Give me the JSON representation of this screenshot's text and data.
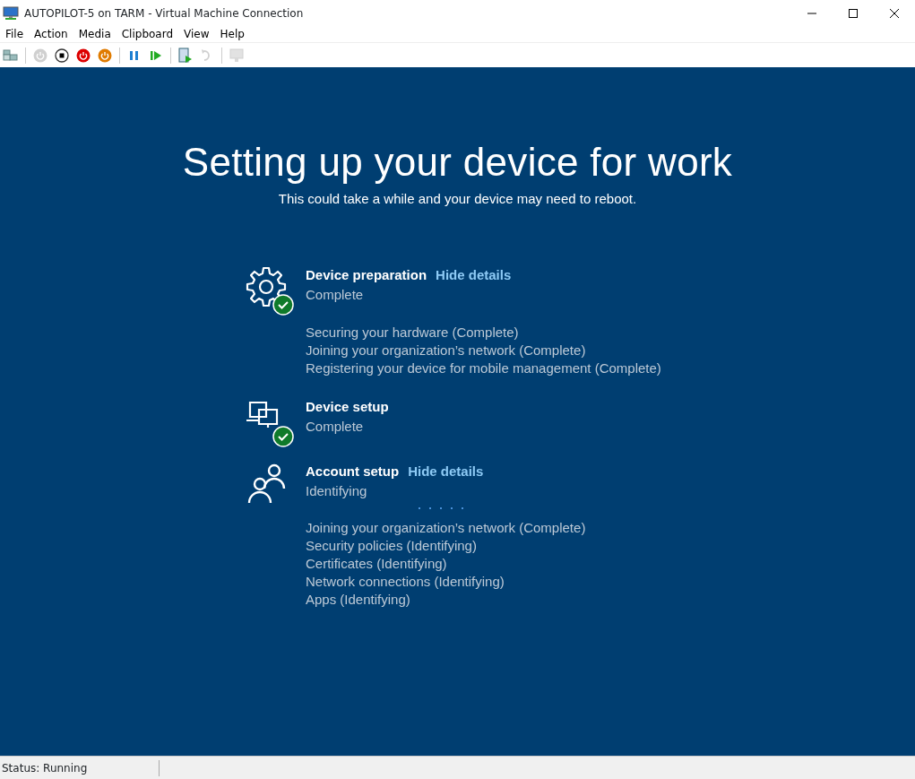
{
  "window": {
    "title": "AUTOPILOT-5 on TARM - Virtual Machine Connection"
  },
  "menu": [
    "File",
    "Action",
    "Media",
    "Clipboard",
    "View",
    "Help"
  ],
  "toolbar": [
    {
      "kind": "ctrlaltdel",
      "disabled": false
    },
    {
      "kind": "sep"
    },
    {
      "kind": "start",
      "disabled": true
    },
    {
      "kind": "turnoff",
      "disabled": false
    },
    {
      "kind": "shutdown",
      "disabled": false
    },
    {
      "kind": "save",
      "disabled": false
    },
    {
      "kind": "sep"
    },
    {
      "kind": "pause",
      "disabled": false
    },
    {
      "kind": "reset",
      "disabled": false
    },
    {
      "kind": "sep"
    },
    {
      "kind": "checkpoint",
      "disabled": false
    },
    {
      "kind": "revert",
      "disabled": true
    },
    {
      "kind": "sep"
    },
    {
      "kind": "session",
      "disabled": true
    }
  ],
  "screen": {
    "heading": "Setting up your device for work",
    "subheading": "This could take a while and your device may need to reboot.",
    "sections": [
      {
        "kind": "gear",
        "title": "Device preparation",
        "link": "Hide details",
        "complete": true,
        "busy": false,
        "status": "Complete",
        "details": [
          "Securing your hardware (Complete)",
          "Joining your organization’s network (Complete)",
          "Registering your device for mobile management (Complete)"
        ]
      },
      {
        "kind": "devices",
        "title": "Device setup",
        "complete": true,
        "busy": false,
        "status": "Complete"
      },
      {
        "kind": "people",
        "title": "Account setup",
        "link": "Hide details",
        "complete": false,
        "busy": true,
        "status": "Identifying",
        "details": [
          "Joining your organization’s network (Complete)",
          "Security policies (Identifying)",
          "Certificates (Identifying)",
          "Network connections (Identifying)",
          "Apps (Identifying)"
        ]
      }
    ]
  },
  "status_bar": {
    "status": "Status: Running"
  }
}
